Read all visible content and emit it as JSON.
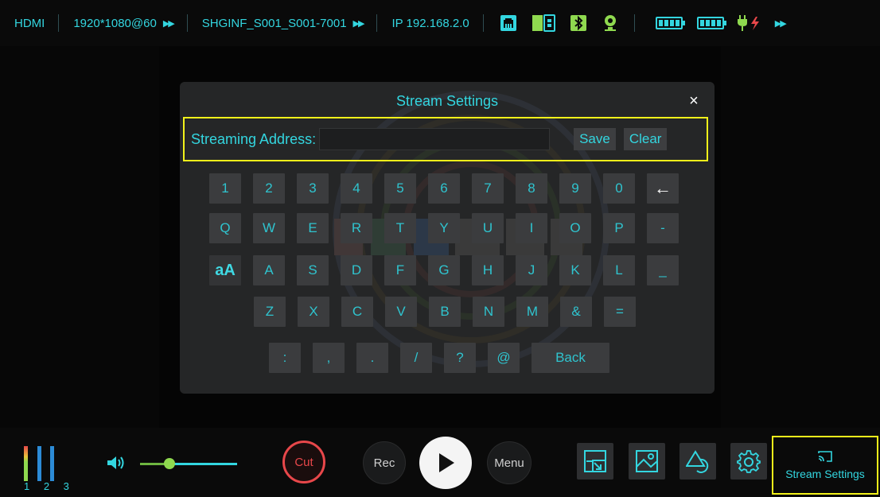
{
  "topbar": {
    "input": "HDMI",
    "resolution": "1920*1080@60",
    "filename": "SHGINF_S001_S001-7001",
    "ip": "IP 192.168.2.0",
    "icons": [
      "ethernet-icon",
      "sd-card-icon",
      "bluetooth-icon",
      "webcam-icon"
    ],
    "batteries": [
      "battery-1-icon",
      "battery-2-icon"
    ],
    "power_icon": "dc-power-icon"
  },
  "modal": {
    "title": "Stream Settings",
    "close_glyph": "×",
    "address_label": "Streaming Address:",
    "address_value": "",
    "address_placeholder": "",
    "save_label": "Save",
    "clear_label": "Clear",
    "keyboard": {
      "row1": [
        "1",
        "2",
        "3",
        "4",
        "5",
        "6",
        "7",
        "8",
        "9",
        "0",
        "←"
      ],
      "row2": [
        "Q",
        "W",
        "E",
        "R",
        "T",
        "Y",
        "U",
        "I",
        "O",
        "P",
        "-"
      ],
      "row3": [
        "aA",
        "A",
        "S",
        "D",
        "F",
        "G",
        "H",
        "J",
        "K",
        "L",
        "_"
      ],
      "row4": [
        "Z",
        "X",
        "C",
        "V",
        "B",
        "N",
        "M",
        "&",
        "="
      ],
      "row5": [
        ":",
        ",",
        ".",
        "/",
        "?",
        "@",
        "Back"
      ]
    }
  },
  "bottombar": {
    "meter_labels": "1 2 3",
    "volume_level": 0.3,
    "cut_label": "Cut",
    "rec_label": "Rec",
    "menu_label": "Menu",
    "tools": [
      "pip-icon",
      "image-icon",
      "shapes-icon",
      "gear-icon"
    ],
    "stream_label": "Stream Settings",
    "stream_icon": "cast-icon"
  },
  "colors": {
    "accent": "#33d6e0",
    "highlight": "#f2f21a",
    "cut": "#e8474a",
    "modal_bg": "#252627",
    "key_bg": "#3b3c3e"
  }
}
